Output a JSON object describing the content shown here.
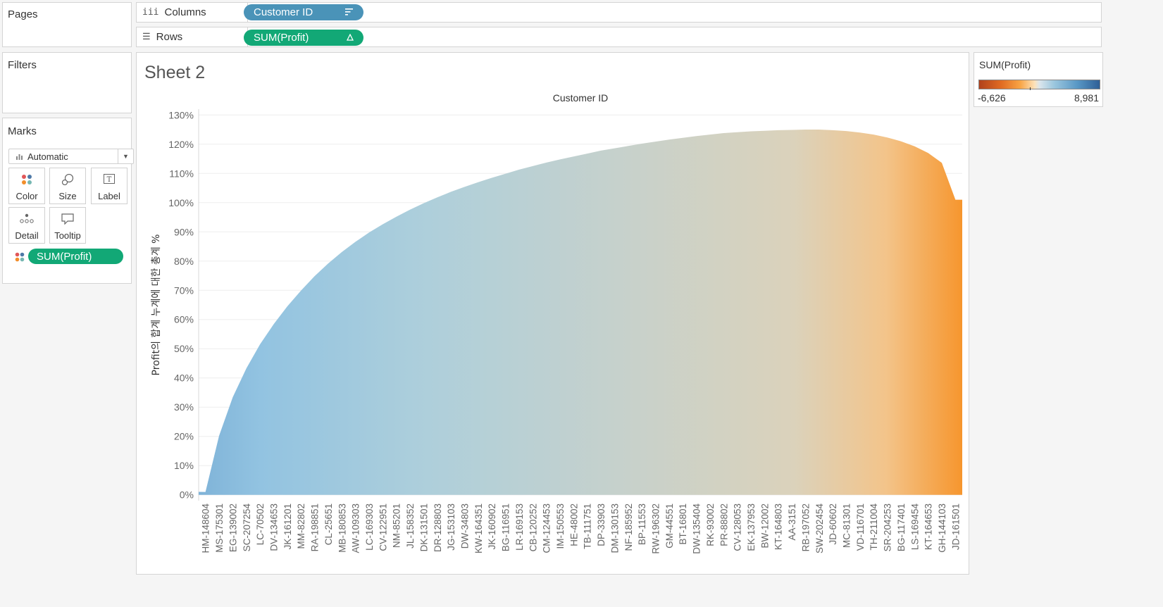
{
  "pages": {
    "title": "Pages"
  },
  "filters": {
    "title": "Filters"
  },
  "marks": {
    "title": "Marks",
    "mark_type": "Automatic",
    "buttons": {
      "color": "Color",
      "size": "Size",
      "label": "Label",
      "detail": "Detail",
      "tooltip": "Tooltip"
    },
    "field_pill": "SUM(Profit)"
  },
  "columns_shelf": {
    "label": "Columns",
    "pill": "Customer ID"
  },
  "rows_shelf": {
    "label": "Rows",
    "pill": "SUM(Profit)"
  },
  "sheet": {
    "title": "Sheet 2"
  },
  "legend": {
    "title": "SUM(Profit)",
    "min_label": "-6,626",
    "max_label": "8,981"
  },
  "colors": {
    "accent_blue": "#4a93b8",
    "accent_green": "#12a876",
    "positive": "#92c3e1",
    "negative": "#f6a14b"
  },
  "chart_data": {
    "type": "area",
    "title": "Customer ID",
    "ylabel": "Profit의 합계 누계에 대한 총계 %",
    "y_unit": "%",
    "ylim": [
      -2,
      132
    ],
    "yticks": [
      0,
      10,
      20,
      30,
      40,
      50,
      60,
      70,
      80,
      90,
      100,
      110,
      120,
      130
    ],
    "ytick_labels": [
      "0%",
      "10%",
      "20%",
      "30%",
      "40%",
      "50%",
      "60%",
      "70%",
      "80%",
      "90%",
      "100%",
      "110%",
      "120%",
      "130%"
    ],
    "grid": true,
    "categories": [
      "HM-148604",
      "MS-175301",
      "EG-139002",
      "SC-207254",
      "LC-70502",
      "DV-134653",
      "JK-161201",
      "MM-82802",
      "RA-198851",
      "CL-25651",
      "MB-180853",
      "AW-109303",
      "LC-169303",
      "CV-122951",
      "NM-85201",
      "JL-158352",
      "DK-131501",
      "DR-128803",
      "JG-153103",
      "DW-34803",
      "KW-164351",
      "JK-160902",
      "BG-116951",
      "LR-169153",
      "CB-120252",
      "CM-124453",
      "IM-150553",
      "HE-48002",
      "TB-111751",
      "DP-33903",
      "DM-130153",
      "NF-185952",
      "BP-11553",
      "RW-196302",
      "GM-44551",
      "BT-16801",
      "DW-135404",
      "RK-93002",
      "PR-88802",
      "CV-128053",
      "EK-137953",
      "BW-12002",
      "KT-164803",
      "AA-3151",
      "RB-197052",
      "SW-202454",
      "JD-60602",
      "MC-81301",
      "VD-116701",
      "TH-211004",
      "SR-204253",
      "BG-117401",
      "LS-169454",
      "KT-164653",
      "GH-144103",
      "JD-161501"
    ],
    "series": [
      {
        "values": [
          1.0,
          20.2,
          33.4,
          43.3,
          51.5,
          58.4,
          64.5,
          69.9,
          74.8,
          79.2,
          83.1,
          86.6,
          89.8,
          92.6,
          95.2,
          97.6,
          99.8,
          101.8,
          103.7,
          105.4,
          107.0,
          108.5,
          109.9,
          111.3,
          112.5,
          113.7,
          114.8,
          115.8,
          116.8,
          117.8,
          118.6,
          119.4,
          120.2,
          120.9,
          121.6,
          122.2,
          122.8,
          123.3,
          123.8,
          124.1,
          124.4,
          124.6,
          124.8,
          124.9,
          125.0,
          125.0,
          124.8,
          124.5,
          124.0,
          123.3,
          122.3,
          121.0,
          119.3,
          117.0,
          113.6,
          101.0
        ]
      }
    ],
    "color_scale": {
      "field": "SUM(Profit)",
      "min": -6626,
      "max": 8981
    }
  }
}
